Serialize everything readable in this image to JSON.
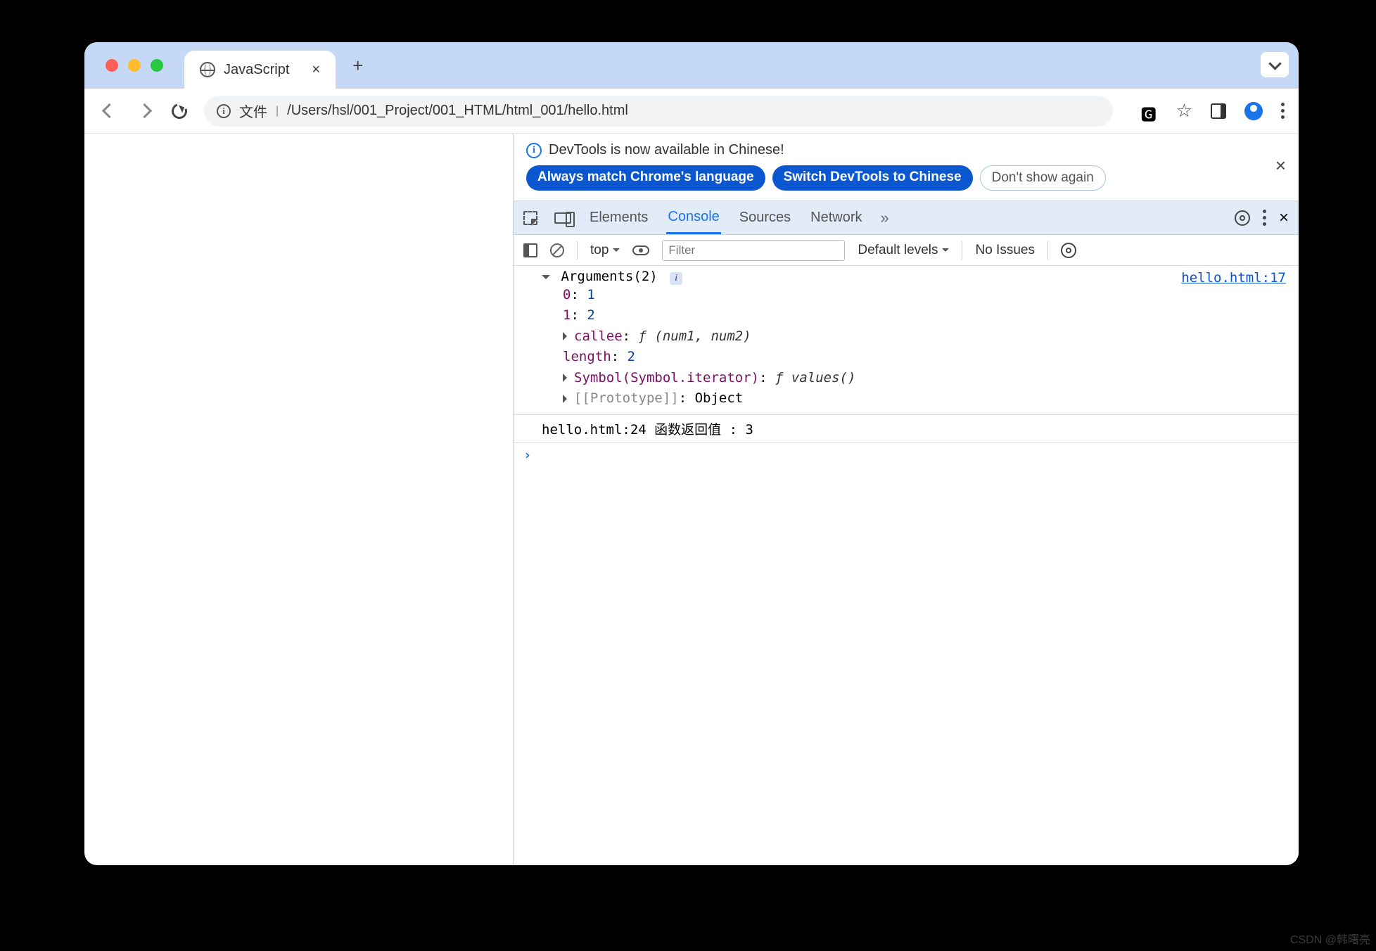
{
  "tab": {
    "title": "JavaScript"
  },
  "addr": {
    "scheme_label": "文件",
    "path": "/Users/hsl/001_Project/001_HTML/html_001/hello.html"
  },
  "infobar": {
    "msg": "DevTools is now available in Chinese!",
    "btn_match": "Always match Chrome's language",
    "btn_switch": "Switch DevTools to Chinese",
    "btn_dont": "Don't show again"
  },
  "dt_tabs": {
    "elements": "Elements",
    "console": "Console",
    "sources": "Sources",
    "network": "Network"
  },
  "ctoolbar": {
    "context": "top",
    "filter_placeholder": "Filter",
    "levels": "Default levels",
    "issues": "No Issues"
  },
  "log1": {
    "header": "Arguments(2)",
    "link": "hello.html:17",
    "p0_k": "0",
    "p0_v": "1",
    "p1_k": "1",
    "p1_v": "2",
    "callee_k": "callee",
    "callee_v": "ƒ (num1, num2)",
    "len_k": "length",
    "len_v": "2",
    "sym_k": "Symbol(Symbol.iterator)",
    "sym_v": "ƒ values()",
    "proto_k": "[[Prototype]]",
    "proto_v": "Object"
  },
  "log2": {
    "text": "函数返回值 : 3",
    "link": "hello.html:24"
  },
  "watermark": "CSDN @韩曙亮"
}
